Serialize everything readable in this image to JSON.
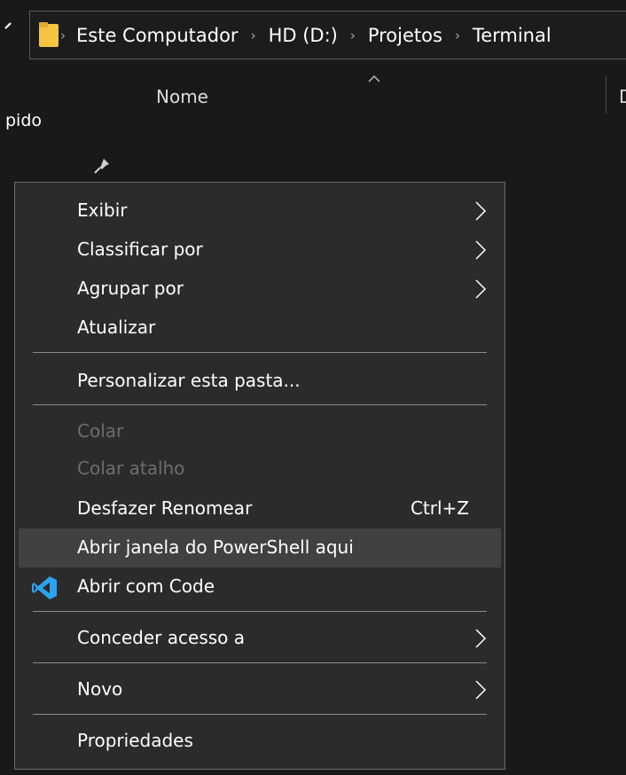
{
  "address_bar": {
    "crumbs": [
      "Este Computador",
      "HD (D:)",
      "Projetos",
      "Terminal"
    ],
    "folder_icon": "folder-icon",
    "separator_icon": "chevron-right-icon"
  },
  "sidebar": {
    "quick_access_fragment": "pido",
    "pin_icon": "pin-icon"
  },
  "list": {
    "column_name": "Nome",
    "column_next_fragment": "D"
  },
  "context_menu": {
    "items": [
      {
        "label": "Exibir",
        "submenu": true
      },
      {
        "label": "Classificar por",
        "submenu": true
      },
      {
        "label": "Agrupar por",
        "submenu": true
      },
      {
        "label": "Atualizar"
      },
      {
        "label": "Personalizar esta pasta..."
      },
      {
        "label": "Colar",
        "disabled": true
      },
      {
        "label": "Colar atalho",
        "disabled": true
      },
      {
        "label": "Desfazer Renomear",
        "shortcut": "Ctrl+Z"
      },
      {
        "label": "Abrir janela do PowerShell aqui",
        "highlighted": true
      },
      {
        "label": "Abrir com Code",
        "icon": "vscode-icon"
      },
      {
        "label": "Conceder acesso a",
        "submenu": true
      },
      {
        "label": "Novo",
        "submenu": true
      },
      {
        "label": "Propriedades"
      }
    ]
  },
  "colors": {
    "background": "#191919",
    "menu_background": "#2b2b2b",
    "menu_hover": "#414141",
    "folder_yellow": "#f5c542",
    "vscode_blue": "#2aa3f0"
  }
}
